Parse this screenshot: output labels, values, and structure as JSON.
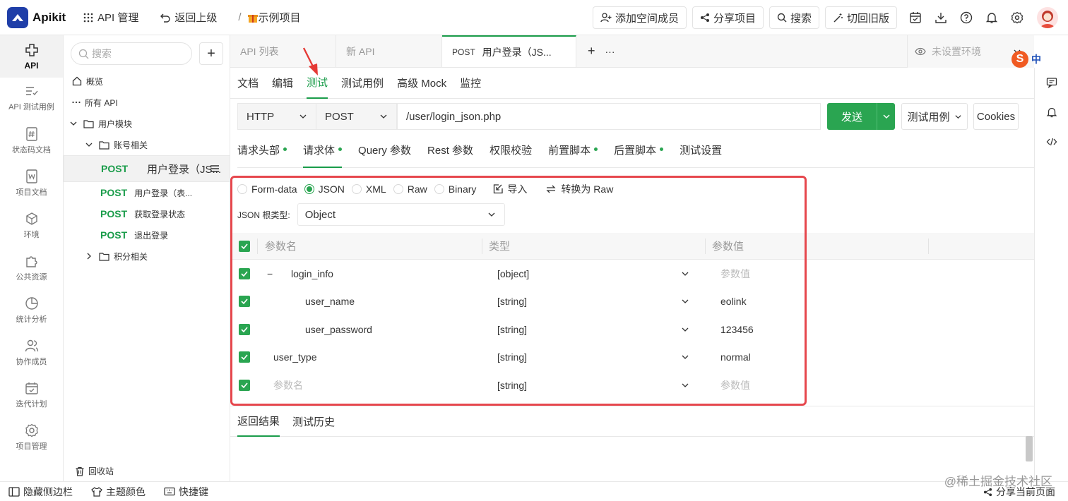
{
  "app": {
    "name": "Apikit"
  },
  "topnav": {
    "api_manage": "API 管理",
    "back": "返回上级",
    "sep": "/",
    "project": "示例项目"
  },
  "top_actions": {
    "add_member": "添加空间成员",
    "share": "分享项目",
    "search": "搜索",
    "old_version": "切回旧版"
  },
  "rail": [
    {
      "label": "API",
      "icon": "api-icon"
    },
    {
      "label": "API 测试用例",
      "icon": "test-case-icon"
    },
    {
      "label": "状态码文档",
      "icon": "status-code-icon"
    },
    {
      "label": "项目文档",
      "icon": "doc-icon"
    },
    {
      "label": "环境",
      "icon": "env-icon"
    },
    {
      "label": "公共资源",
      "icon": "puzzle-icon"
    },
    {
      "label": "统计分析",
      "icon": "pie-chart-icon"
    },
    {
      "label": "协作成员",
      "icon": "members-icon"
    },
    {
      "label": "迭代计划",
      "icon": "calendar-icon"
    },
    {
      "label": "项目管理",
      "icon": "gear-icon"
    }
  ],
  "tree": {
    "search_placeholder": "搜索",
    "add": "+",
    "overview": "概览",
    "all_api": "所有 API",
    "user_module": "用户模块",
    "account": "账号相关",
    "apis": [
      {
        "method": "POST",
        "name": "用户登录（JS..."
      },
      {
        "method": "POST",
        "name": "用户登录（表..."
      },
      {
        "method": "POST",
        "name": "获取登录状态"
      },
      {
        "method": "POST",
        "name": "退出登录"
      }
    ],
    "points": "积分相关",
    "recycle": "回收站"
  },
  "tabs": {
    "api_list": "API 列表",
    "new_api": "新 API",
    "active_method": "POST",
    "active_name": "用户登录（JS...",
    "plus": "+",
    "more": "···",
    "env": "未设置环境"
  },
  "ime": {
    "s": "S",
    "zh": "中"
  },
  "subtabs": [
    "文档",
    "编辑",
    "测试",
    "测试用例",
    "高级 Mock",
    "监控"
  ],
  "request": {
    "protocol": "HTTP",
    "method": "POST",
    "url": "/user/login_json.php",
    "send": "发送",
    "test_case": "测试用例",
    "cookies": "Cookies"
  },
  "reqtabs": [
    {
      "label": "请求头部",
      "dot": true
    },
    {
      "label": "请求体",
      "dot": true
    },
    {
      "label": "Query 参数",
      "dot": false
    },
    {
      "label": "Rest 参数",
      "dot": false
    },
    {
      "label": "权限校验",
      "dot": false
    },
    {
      "label": "前置脚本",
      "dot": true
    },
    {
      "label": "后置脚本",
      "dot": true
    },
    {
      "label": "测试设置",
      "dot": false
    }
  ],
  "body_types": [
    "Form-data",
    "JSON",
    "XML",
    "Raw",
    "Binary"
  ],
  "body_actions": {
    "import": "导入",
    "to_raw": "转换为 Raw"
  },
  "json_root": {
    "label": "JSON 根类型:",
    "value": "Object"
  },
  "params_header": {
    "name": "参数名",
    "type": "类型",
    "value": "参数值"
  },
  "params": [
    {
      "name": "login_info",
      "type": "[object]",
      "value": "参数值",
      "value_placeholder": true,
      "level": 0,
      "collapse": "−"
    },
    {
      "name": "user_name",
      "type": "[string]",
      "value": "eolink",
      "value_placeholder": false,
      "level": 1
    },
    {
      "name": "user_password",
      "type": "[string]",
      "value": "123456",
      "value_placeholder": false,
      "level": 1
    },
    {
      "name": "user_type",
      "type": "[string]",
      "value": "normal",
      "value_placeholder": false,
      "level": 0
    },
    {
      "name": "参数名",
      "type": "[string]",
      "value": "参数值",
      "value_placeholder": true,
      "level": 0,
      "name_placeholder": true
    }
  ],
  "result_tabs": [
    "返回结果",
    "测试历史"
  ],
  "bottom": {
    "hide_sidebar": "隐藏侧边栏",
    "theme": "主题颜色",
    "shortcuts": "快捷键",
    "share_page": "分享当前页面",
    "watermark": "@稀土掘金技术社区"
  },
  "colors": {
    "accent": "#1a9c4a",
    "send": "#2aa551",
    "highlight": "#e6474d",
    "logo": "#1f3ea8"
  }
}
